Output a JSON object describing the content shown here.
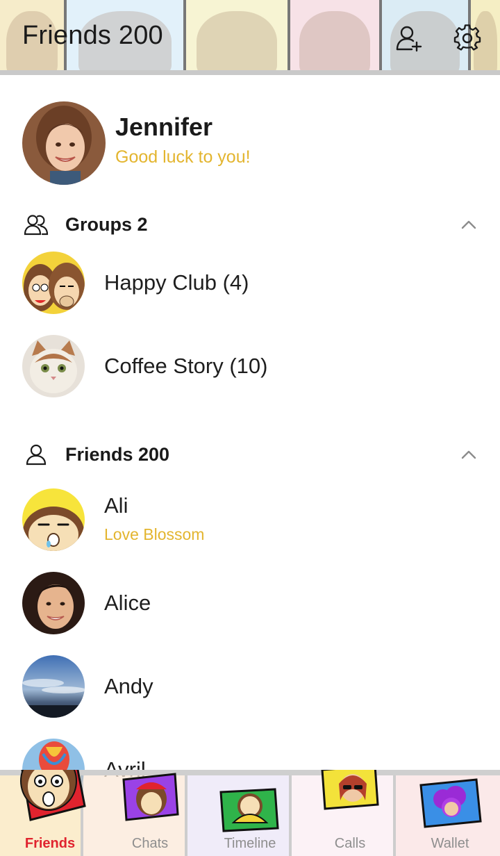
{
  "header": {
    "title": "Friends 200",
    "add_friend_icon": "add-friend-icon",
    "settings_icon": "gear-icon"
  },
  "profile": {
    "name": "Jennifer",
    "status": "Good luck to you!"
  },
  "groups_section": {
    "title": "Groups 2",
    "icon": "group-icon",
    "items": [
      {
        "label": "Happy Club (4)"
      },
      {
        "label": "Coffee Story (10)"
      }
    ]
  },
  "friends_section": {
    "title": "Friends 200",
    "icon": "person-icon",
    "items": [
      {
        "name": "Ali",
        "status": "Love Blossom"
      },
      {
        "name": "Alice",
        "status": ""
      },
      {
        "name": "Andy",
        "status": ""
      },
      {
        "name": "Avril",
        "status": ""
      }
    ]
  },
  "tabs": [
    {
      "label": "Friends",
      "active": true
    },
    {
      "label": "Chats",
      "active": false
    },
    {
      "label": "Timeline",
      "active": false
    },
    {
      "label": "Calls",
      "active": false
    },
    {
      "label": "Wallet",
      "active": false
    }
  ],
  "colors": {
    "accent_status": "#e3b52f",
    "active_tab": "#e0232e",
    "inactive_tab": "#8e8e8e"
  }
}
